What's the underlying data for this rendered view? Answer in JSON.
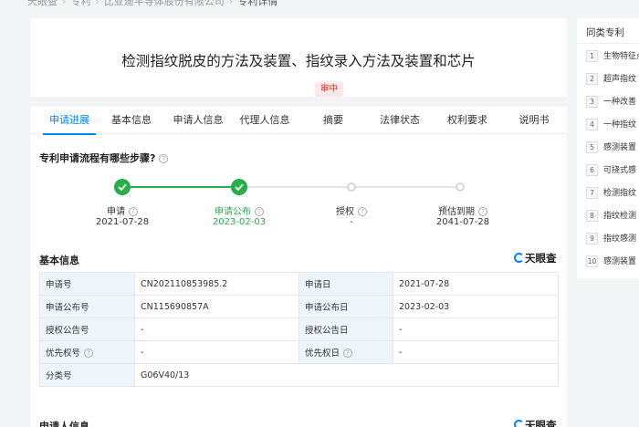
{
  "breadcrumb": {
    "items": [
      "天眼查",
      "专利",
      "比亚迪半导体股份有限公司"
    ],
    "current": "专利详情"
  },
  "patent": {
    "title": "检测指纹脱皮的方法及装置、指纹录入方法及装置和芯片",
    "status": "审中"
  },
  "tabs": [
    "申请进展",
    "基本信息",
    "申请人信息",
    "代理人信息",
    "摘要",
    "法律状态",
    "权利要求",
    "说明书"
  ],
  "progress": {
    "question": "专利申请流程有哪些步骤?",
    "steps": [
      {
        "label": "申请",
        "date": "2021-07-28",
        "done": true
      },
      {
        "label": "申请公布",
        "date": "2023-02-03",
        "done": true,
        "current": true
      },
      {
        "label": "授权",
        "date": "-",
        "done": false
      },
      {
        "label": "预估到期",
        "date": "2041-07-28",
        "done": false
      }
    ]
  },
  "basic_info": {
    "title": "基本信息",
    "brand": "天眼查",
    "rows": [
      {
        "k1": "申请号",
        "v1": "CN202110853985.2",
        "k2": "申请日",
        "v2": "2021-07-28"
      },
      {
        "k1": "申请公布号",
        "v1": "CN115690857A",
        "k2": "申请公布日",
        "v2": "2023-02-03"
      },
      {
        "k1": "授权公告号",
        "v1": "-",
        "k2": "授权公告日",
        "v2": "-"
      },
      {
        "k1": "优先权号",
        "v1": "-",
        "k2": "优先权日",
        "v2": "-"
      },
      {
        "k1": "分类号",
        "v1": "G06V40/13"
      }
    ]
  },
  "applicant_info": {
    "title": "申请人信息",
    "brand": "天眼查"
  },
  "similar": {
    "title": "同类专利",
    "items": [
      {
        "num": "1",
        "text": "生物特征点"
      },
      {
        "num": "2",
        "text": "超声指纹"
      },
      {
        "num": "3",
        "text": "一种改善"
      },
      {
        "num": "4",
        "text": "一种指纹"
      },
      {
        "num": "5",
        "text": "感测装置"
      },
      {
        "num": "6",
        "text": "可挠式感"
      },
      {
        "num": "7",
        "text": "检测指纹"
      },
      {
        "num": "8",
        "text": "指纹检测"
      },
      {
        "num": "9",
        "text": "指纹感测"
      },
      {
        "num": "10",
        "text": "感测装置"
      }
    ]
  },
  "colors": {
    "accent": "#0084ff",
    "done": "#27ae4a",
    "status_bg": "#fde8e8",
    "status_fg": "#e2231a",
    "table_key_bg": "#eef5fb"
  }
}
